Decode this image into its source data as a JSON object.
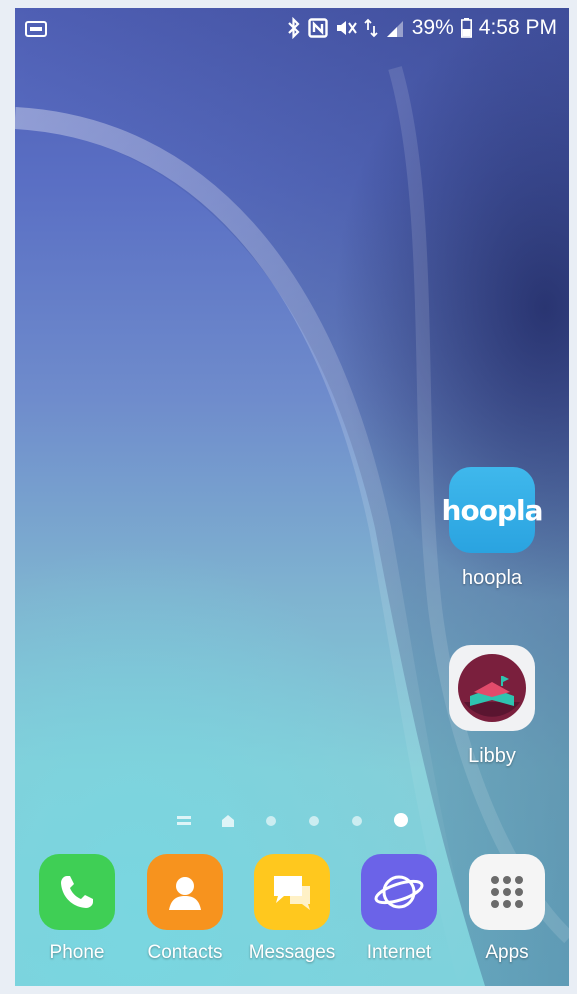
{
  "status_bar": {
    "left_icon": "screen-mirror-icon",
    "icons": [
      "bluetooth-icon",
      "nfc-icon",
      "mute-icon",
      "data-roaming-icon",
      "signal-icon"
    ],
    "battery_percent": "39%",
    "time": "4:58 PM"
  },
  "desktop_apps": [
    {
      "label": "hoopla",
      "icon": "hoopla-icon",
      "logo_text": "hoopla",
      "color": "#2fabe6"
    },
    {
      "label": "Libby",
      "icon": "libby-icon",
      "color": "#7a1f3d"
    }
  ],
  "page_indicator": {
    "pages": [
      "menu",
      "home",
      "dot",
      "dot",
      "dot",
      "dot"
    ],
    "active_index": 5
  },
  "dock": [
    {
      "label": "Phone",
      "icon": "phone-icon",
      "color": "#3fcf55"
    },
    {
      "label": "Contacts",
      "icon": "contacts-icon",
      "color": "#f7931e"
    },
    {
      "label": "Messages",
      "icon": "messages-icon",
      "color": "#ffc81e"
    },
    {
      "label": "Internet",
      "icon": "internet-icon",
      "color": "#6b63e8"
    },
    {
      "label": "Apps",
      "icon": "apps-grid-icon",
      "color": "#f5f5f5"
    }
  ]
}
